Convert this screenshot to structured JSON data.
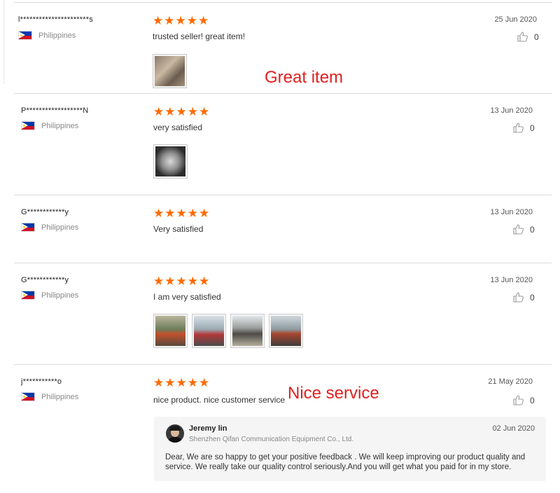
{
  "reviews": [
    {
      "user": "l**********************s",
      "country": "Philippines",
      "comment": "trusted seller! great item!",
      "date": "25 Jun 2020",
      "likes": "0",
      "rating": 5,
      "photos": [
        {
          "icon": "review-photo"
        }
      ]
    },
    {
      "user": "P******************N",
      "country": "Philippines",
      "comment": "very satisfied",
      "date": "13 Jun 2020",
      "likes": "0",
      "rating": 5,
      "photos": [
        {
          "icon": "review-photo"
        }
      ]
    },
    {
      "user": "G************y",
      "country": "Philippines",
      "comment": "Very satisfied",
      "date": "13 Jun 2020",
      "likes": "0",
      "rating": 5,
      "photos": []
    },
    {
      "user": "G************y",
      "country": "Philippines",
      "comment": "I am very satisfied",
      "date": "13 Jun 2020",
      "likes": "0",
      "rating": 5,
      "photos": [
        {
          "icon": "review-photo"
        },
        {
          "icon": "review-photo"
        },
        {
          "icon": "review-photo"
        },
        {
          "icon": "review-photo"
        }
      ]
    },
    {
      "user": "j***********o",
      "country": "Philippines",
      "comment": "nice product. nice customer service",
      "date": "21 May 2020",
      "likes": "0",
      "rating": 5,
      "photos": []
    }
  ],
  "reply": {
    "name": "Jeremy lin",
    "company": "Shenzhen Qifan Communication Equipment Co., Ltd.",
    "date": "02 Jun 2020",
    "text": "Dear, We are so happy to get your positive feedback . We will keep improving our product quality and service. We really take our quality control seriously.And you will get what you paid for in my store."
  },
  "overlays": {
    "great_item": "Great item",
    "nice_service": "Nice service"
  },
  "colors": {
    "star": "#ff6a00",
    "overlay_text": "#e02020"
  }
}
